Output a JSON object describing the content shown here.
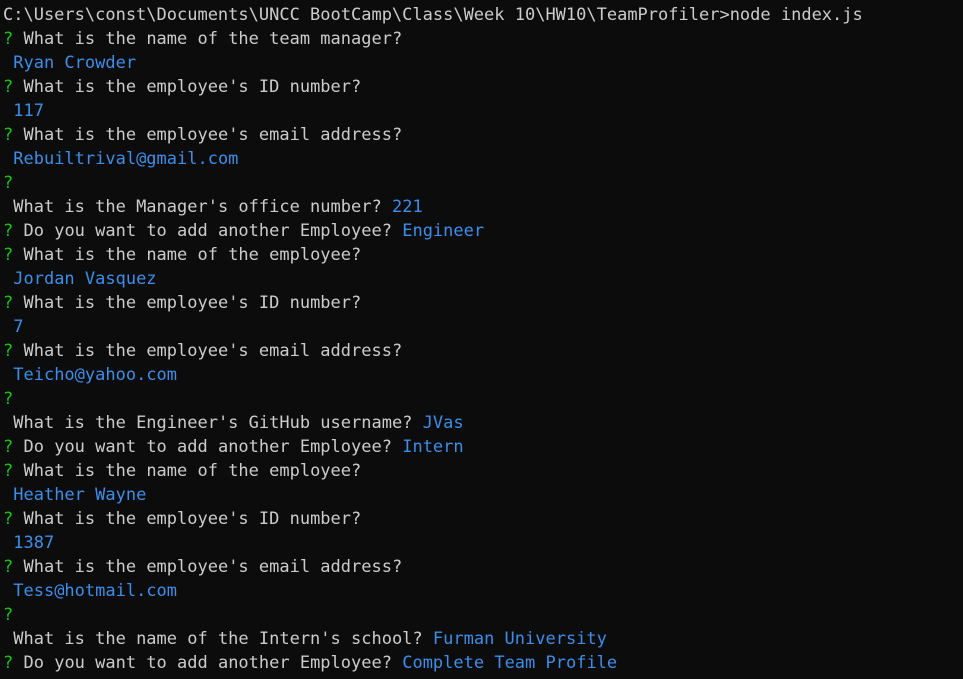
{
  "terminal": {
    "prompt_path": "C:\\Users\\const\\Documents\\UNCC BootCamp\\Class\\Week 10\\HW10\\TeamProfiler>",
    "command": "node index.js",
    "question_mark": "?",
    "questions": {
      "manager_name": "What is the name of the team manager?",
      "employee_id": "What is the employee's ID number?",
      "employee_email": "What is the employee's email address?",
      "manager_office": "What is the Manager's office number?",
      "add_another": "Do you want to add another Employee?",
      "employee_name": "What is the name of the employee?",
      "engineer_github": "What is the Engineer's GitHub username?",
      "intern_school": "What is the name of the Intern's school?"
    },
    "answers": {
      "manager_name": "Ryan Crowder",
      "manager_id": "117",
      "manager_email": "Rebuiltrival@gmail.com",
      "manager_office": "221",
      "add_1": "Engineer",
      "engineer_name": "Jordan Vasquez",
      "engineer_id": "7",
      "engineer_email": "Teicho@yahoo.com",
      "engineer_github": "JVas",
      "add_2": "Intern",
      "intern_name": "Heather Wayne",
      "intern_id": "1387",
      "intern_email": "Tess@hotmail.com",
      "intern_school": "Furman University",
      "add_3": "Complete Team Profile"
    },
    "colors": {
      "background": "#0c0c0c",
      "text": "#cccccc",
      "question_mark": "#16c60c",
      "answer": "#3b8eea"
    }
  }
}
